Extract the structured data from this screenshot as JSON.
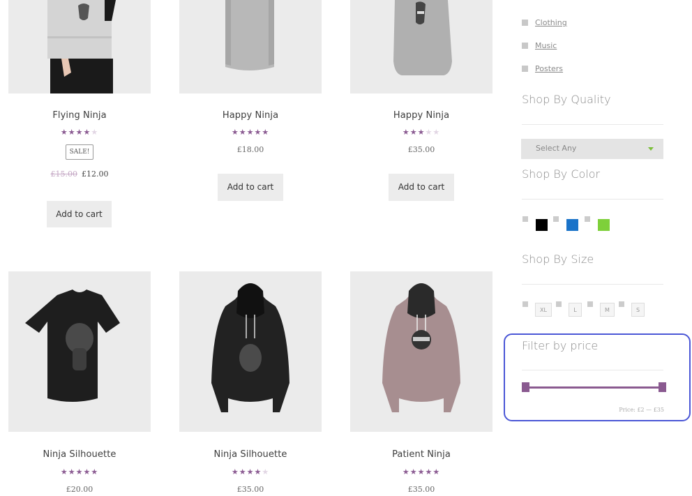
{
  "products": [
    {
      "title": "Flying Ninja",
      "rating": 4,
      "sale_label": "SALE!",
      "old_price": "£15.00",
      "price": "£12.00",
      "button": "Add to cart"
    },
    {
      "title": "Happy Ninja",
      "rating": 5,
      "price": "£18.00",
      "button": "Add to cart"
    },
    {
      "title": "Happy Ninja",
      "rating": 3,
      "price": "£35.00",
      "button": "Add to cart"
    },
    {
      "title": "Ninja Silhouette",
      "rating": 5,
      "price": "£20.00"
    },
    {
      "title": "Ninja Silhouette",
      "rating": 4,
      "price": "£35.00"
    },
    {
      "title": "Patient Ninja",
      "rating": 4.5,
      "price": "£35.00"
    }
  ],
  "sidebar": {
    "categories": [
      "Clothing",
      "Music",
      "Posters"
    ],
    "quality": {
      "title": "Shop By Quality",
      "select_value": "Select Any"
    },
    "color": {
      "title": "Shop By Color",
      "swatches": [
        "#000000",
        "#1a73c9",
        "#7ed03a"
      ]
    },
    "size": {
      "title": "Shop By Size",
      "options": [
        "XL",
        "L",
        "M",
        "S"
      ]
    },
    "price_filter": {
      "title": "Filter by price",
      "range_label": "Price: £2 — £35",
      "min_fraction": 0,
      "max_fraction": 1
    }
  },
  "colors": {
    "accent": "#8a5a90",
    "highlight": "#4a56d6"
  }
}
